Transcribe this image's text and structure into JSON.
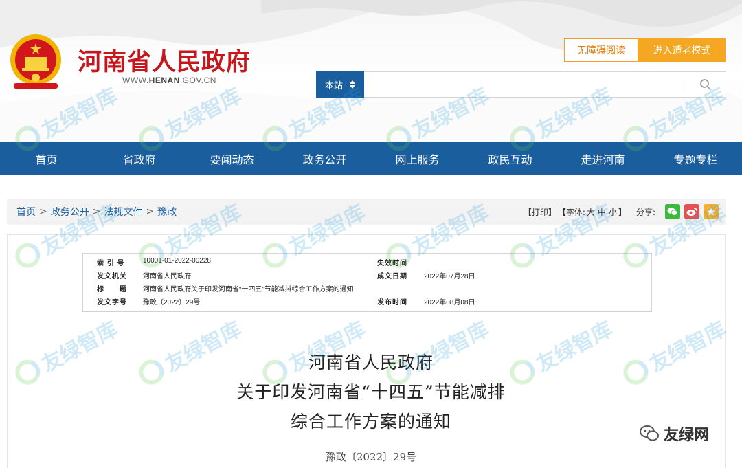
{
  "header": {
    "site_title": "河南省人民政府",
    "site_url_prefix": "WWW.",
    "site_url_domain": "HENAN",
    "site_url_suffix": ".GOV.CN",
    "accessibility_label": "无障碍阅读",
    "elder_mode_label": "进入适老模式",
    "search_scope": "本站",
    "search_value": ""
  },
  "nav": {
    "items": [
      "首页",
      "省政府",
      "要闻动态",
      "政务公开",
      "网上服务",
      "政民互动",
      "走进河南",
      "专题专栏"
    ]
  },
  "breadcrumb": {
    "items": [
      "首页",
      "政务公开",
      "法规文件",
      "豫政"
    ],
    "separator": ">"
  },
  "tools": {
    "print_label": "【打印】",
    "font_prefix": "【字体:",
    "font_large": "大",
    "font_medium": "中",
    "font_small": "小",
    "font_suffix": "】",
    "share_label": "分享:"
  },
  "meta": {
    "index_label": "索 引 号",
    "index_value": "10001-01-2022-00228",
    "expiry_label": "失效时间",
    "expiry_value": "",
    "issuer_label": "发文机关",
    "issuer_value": "河南省人民政府",
    "created_label": "成文日期",
    "created_value": "2022年07月28日",
    "title_label": "标　　题",
    "title_value": "河南省人民政府关于印发河南省“十四五”节能减排综合工作方案的通知",
    "docnum_label": "发文字号",
    "docnum_value": "豫政〔2022〕29号",
    "published_label": "发布时间",
    "published_value": "2022年08月08日"
  },
  "document": {
    "title_line1": "河南省人民政府",
    "title_line2": "关于印发河南省“十四五”节能减排",
    "title_line3": "综合工作方案的通知",
    "doc_number": "豫政〔2022〕29号"
  },
  "watermark": {
    "text": "友绿智库",
    "corner_brand": "友绿网"
  },
  "colors": {
    "brand_red": "#c8161d",
    "nav_blue": "#1b5e9e",
    "accent_orange": "#f5a623"
  }
}
